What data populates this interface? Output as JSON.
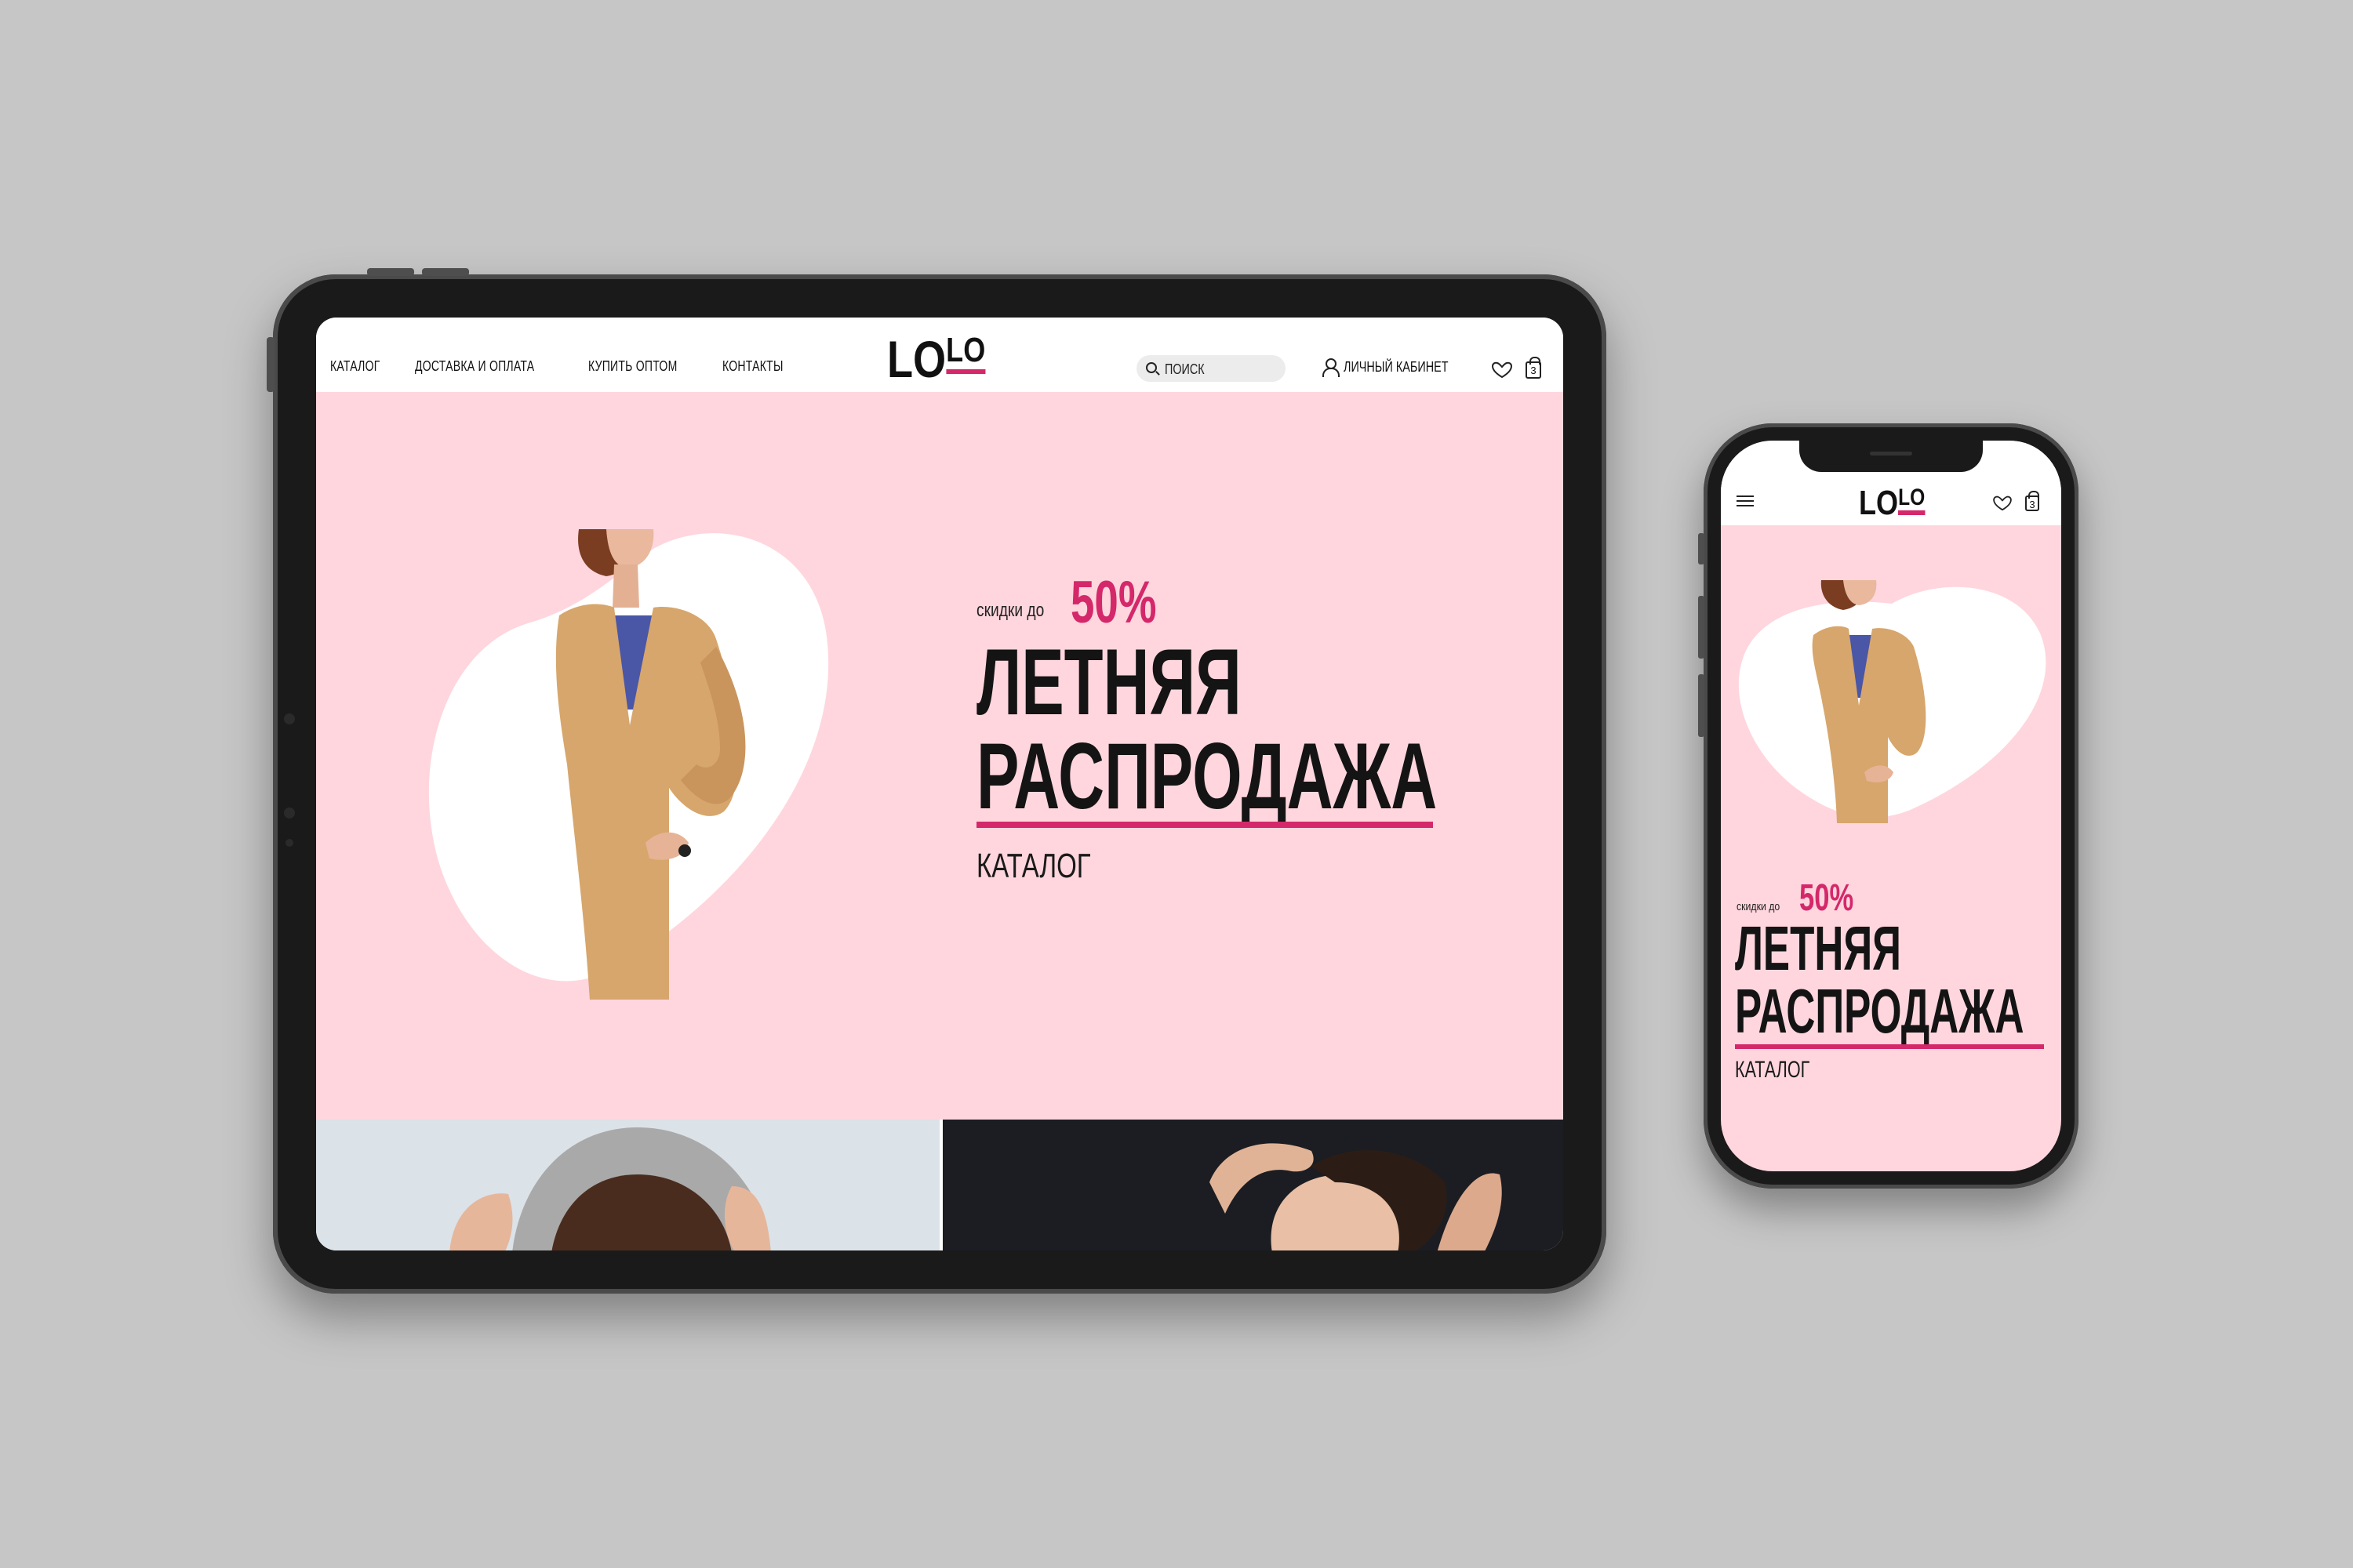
{
  "brand": {
    "logo_big": "LO",
    "logo_small": "LO"
  },
  "nav": [
    {
      "label": "КАТАЛОГ"
    },
    {
      "label": "ДОСТАВКА И ОПЛАТА"
    },
    {
      "label": "КУПИТЬ ОПТОМ"
    },
    {
      "label": "КОНТАКТЫ"
    }
  ],
  "search": {
    "placeholder": "ПОИСК"
  },
  "account": {
    "label": "ЛИЧНЫЙ КАБИНЕТ"
  },
  "cart": {
    "count": "3"
  },
  "icons": {
    "search": "search-icon",
    "user": "user-icon",
    "favorites": "heart-icon",
    "cart": "shopping-bag-icon",
    "menu": "hamburger-menu-icon"
  },
  "hero": {
    "discount_prefix": "скидки до",
    "discount_value": "50%",
    "title_line1": "ЛЕТНЯЯ",
    "title_line2": "РАСПРОДАЖА",
    "cta": "КАТАЛОГ"
  },
  "colors": {
    "accent": "#d4286a",
    "hero_bg": "#ffd6de",
    "page_bg": "#c6c6c6",
    "device": "#1a1a1a",
    "cardigan": "#d7a66c"
  }
}
